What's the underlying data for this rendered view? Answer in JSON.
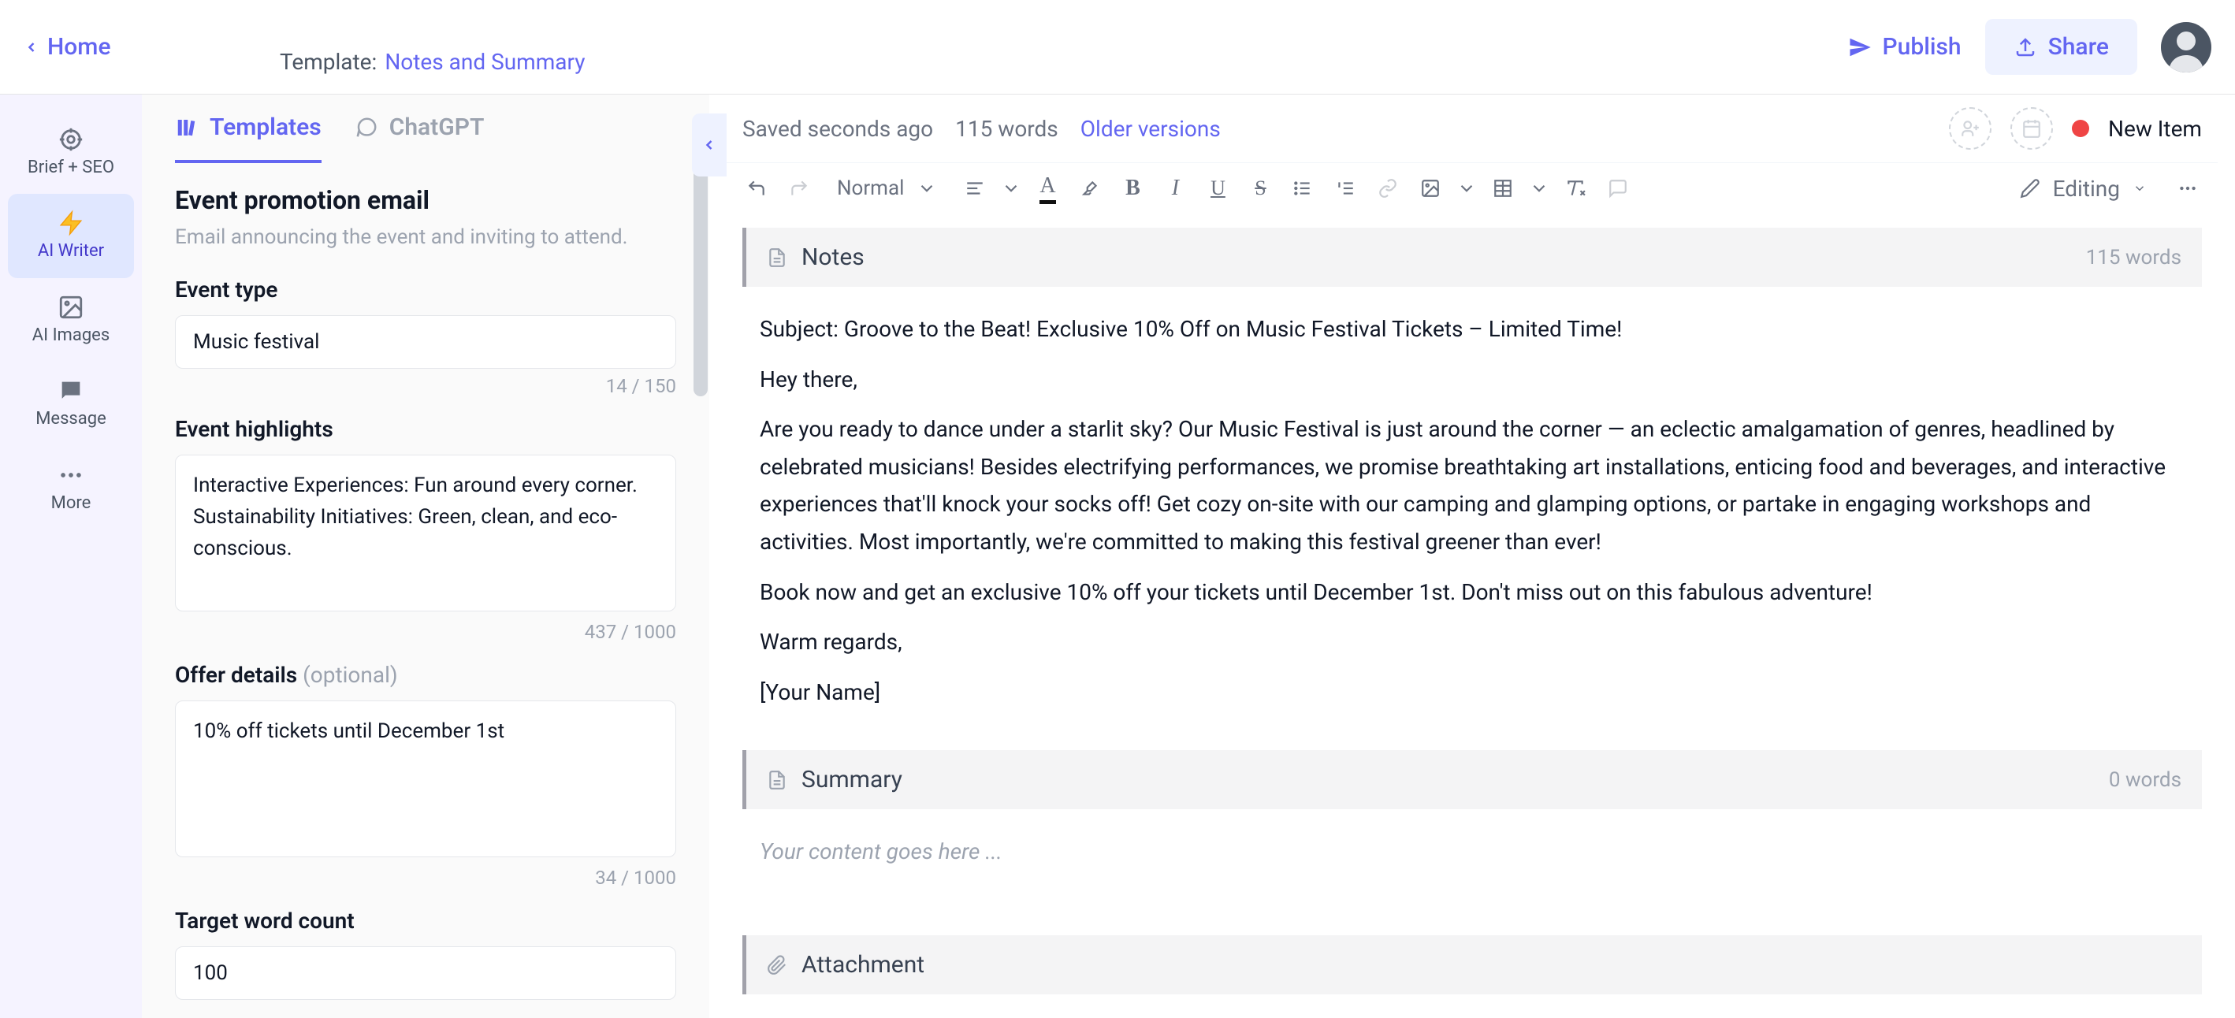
{
  "header": {
    "home": "Home",
    "templatePrefix": "Template:",
    "templateName": "Notes and Summary",
    "publish": "Publish",
    "share": "Share"
  },
  "rail": {
    "briefSeo": "Brief + SEO",
    "aiWriter": "AI Writer",
    "aiImages": "AI Images",
    "message": "Message",
    "more": "More"
  },
  "sidebar": {
    "tabTemplates": "Templates",
    "tabChatGPT": "ChatGPT",
    "title": "Event promotion email",
    "desc": "Email announcing the event and inviting to attend.",
    "fields": {
      "eventTypeLabel": "Event type",
      "eventTypeValue": "Music festival",
      "eventTypeCount": "14 / 150",
      "highlightsLabel": "Event highlights",
      "highlightsValue": "Interactive Experiences: Fun around every corner.\nSustainability Initiatives: Green, clean, and eco-conscious.",
      "highlightsCount": "437 / 1000",
      "offerLabel": "Offer details",
      "offerOptional": "(optional)",
      "offerValue": "10% off tickets until December 1st",
      "offerCount": "34 / 1000",
      "targetLabel": "Target word count",
      "targetValue": "100"
    }
  },
  "editorTop": {
    "saved": "Saved seconds ago",
    "words": "115 words",
    "older": "Older versions",
    "newItem": "New Item"
  },
  "toolbar": {
    "style": "Normal",
    "editing": "Editing"
  },
  "doc": {
    "notes": {
      "title": "Notes",
      "words": "115 words",
      "p1": "Subject: Groove to the Beat! Exclusive 10% Off on Music Festival Tickets – Limited Time!",
      "p2": "Hey there,",
      "p3": "Are you ready to dance under a starlit sky? Our Music Festival is just around the corner — an eclectic amalgamation of genres, headlined by celebrated musicians! Besides electrifying performances, we promise breathtaking art installations, enticing food and beverages, and interactive experiences that'll knock your socks off! Get cozy on-site with our camping and glamping options, or partake in engaging workshops and activities. Most importantly, we're committed to making this festival greener than ever!",
      "p4": "Book now and get an exclusive 10% off your tickets until December 1st. Don't miss out on this fabulous adventure!",
      "p5": "Warm regards,",
      "p6": "[Your Name]"
    },
    "summary": {
      "title": "Summary",
      "words": "0 words",
      "placeholder": "Your content goes here ..."
    },
    "attachment": {
      "title": "Attachment"
    }
  }
}
